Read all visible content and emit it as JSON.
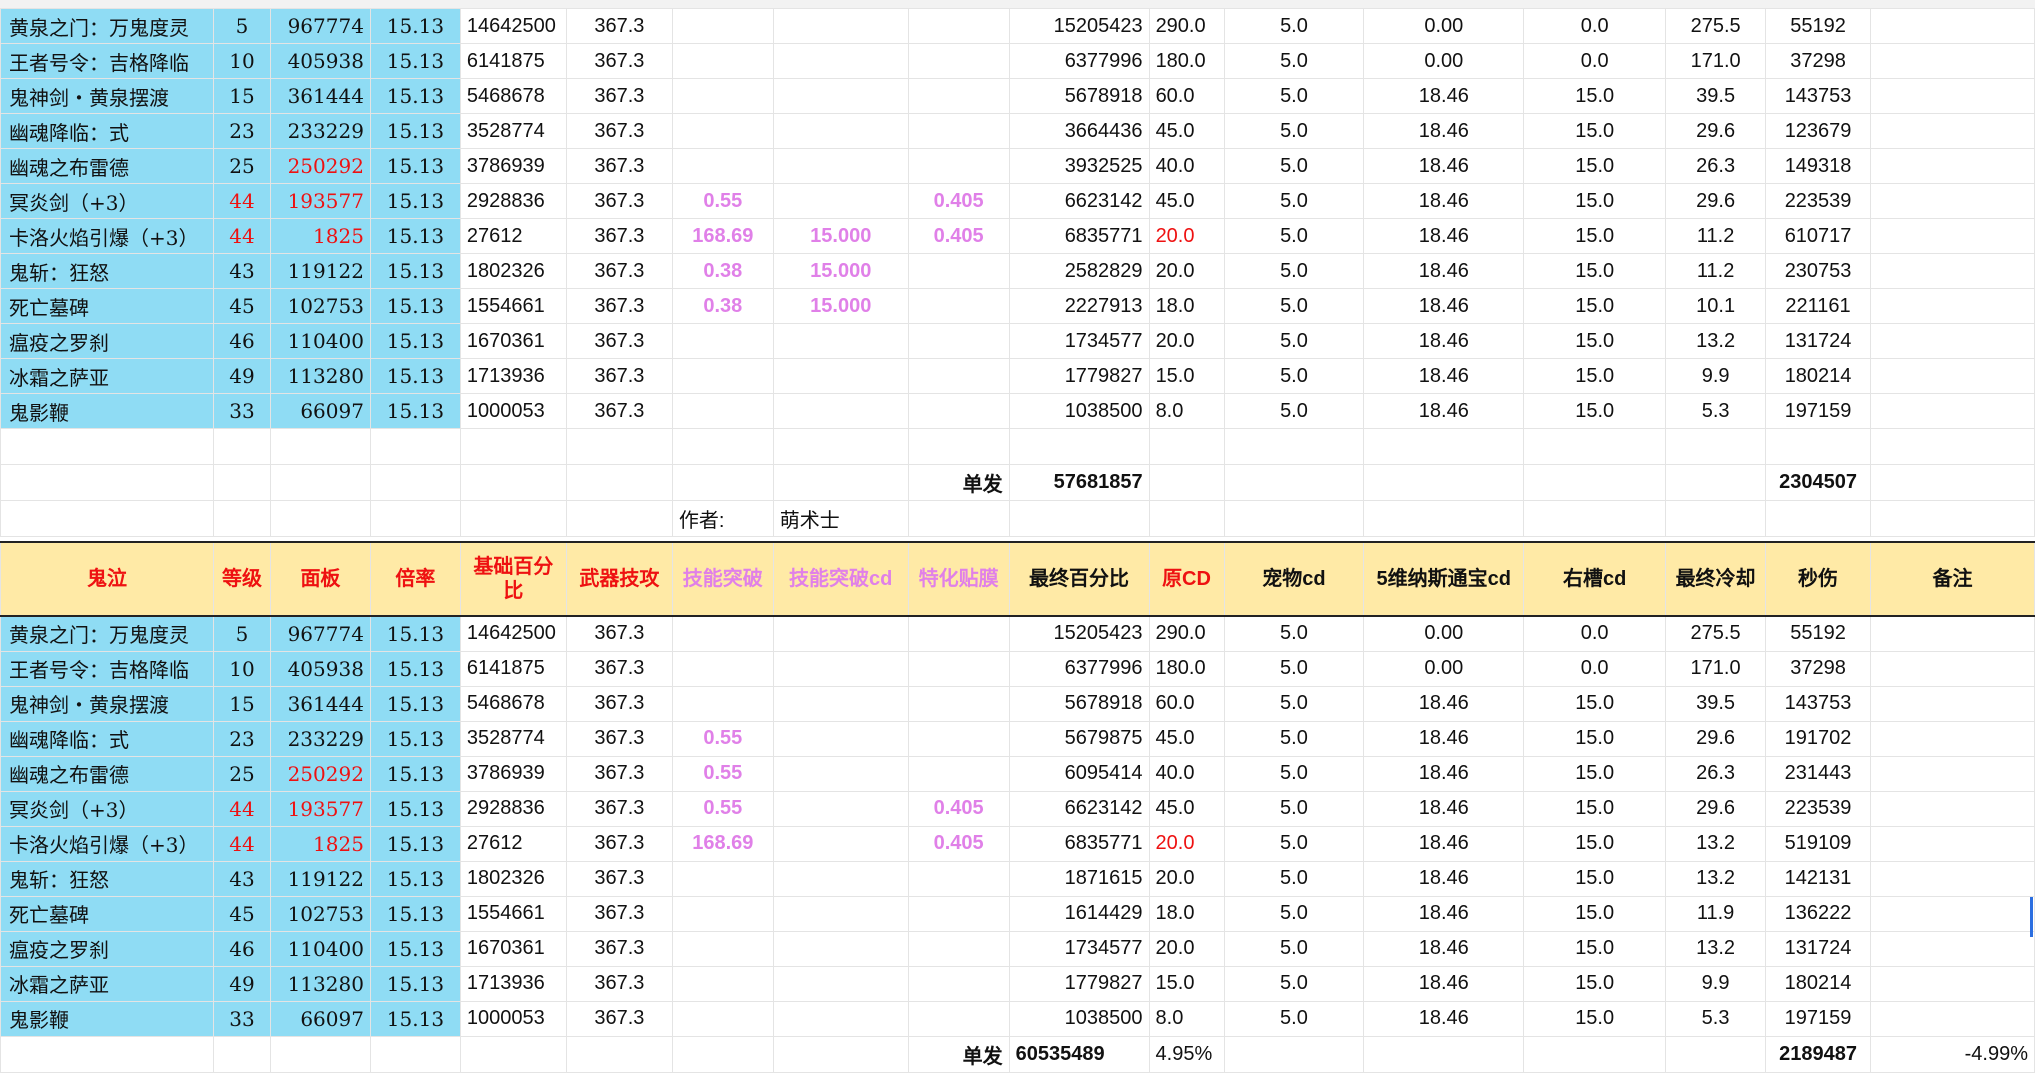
{
  "author_label": "作者:",
  "author_name": "萌术士",
  "header": {
    "c1": "鬼泣",
    "c2": "等级",
    "c3": "面板",
    "c4": "倍率",
    "c5": "基础百分比",
    "c6": "武器技攻",
    "c7": "技能突破",
    "c8": "技能突破cd",
    "c9": "特化贴膜",
    "c10": "最终百分比",
    "c11": "原CD",
    "c12": "宠物cd",
    "c13": "5维纳斯通宝cd",
    "c14": "右槽cd",
    "c15": "最终冷却",
    "c16": "秒伤",
    "c17": "备注"
  },
  "table1": {
    "rows": [
      [
        "黄泉之门：万鬼度灵",
        "5",
        "967774",
        "15.13",
        "14642500",
        "367.3",
        "",
        "",
        "",
        "15205423",
        "290.0",
        "5.0",
        "0.00",
        "0.0",
        "275.5",
        "55192",
        ""
      ],
      [
        "王者号令：吉格降临",
        "10",
        "405938",
        "15.13",
        "6141875",
        "367.3",
        "",
        "",
        "",
        "6377996",
        "180.0",
        "5.0",
        "0.00",
        "0.0",
        "171.0",
        "37298",
        ""
      ],
      [
        "鬼神剑・黄泉摆渡",
        "15",
        "361444",
        "15.13",
        "5468678",
        "367.3",
        "",
        "",
        "",
        "5678918",
        "60.0",
        "5.0",
        "18.46",
        "15.0",
        "39.5",
        "143753",
        ""
      ],
      [
        "幽魂降临：式",
        "23",
        "233229",
        "15.13",
        "3528774",
        "367.3",
        "",
        "",
        "",
        "3664436",
        "45.0",
        "5.0",
        "18.46",
        "15.0",
        "29.6",
        "123679",
        ""
      ],
      [
        "幽魂之布雷德",
        "25",
        "250292",
        "15.13",
        "3786939",
        "367.3",
        "",
        "",
        "",
        "3932525",
        "40.0",
        "5.0",
        "18.46",
        "15.0",
        "26.3",
        "149318",
        ""
      ],
      [
        "冥炎剑（+3）",
        "44",
        "193577",
        "15.13",
        "2928836",
        "367.3",
        "0.55",
        "",
        "0.405",
        "6623142",
        "45.0",
        "5.0",
        "18.46",
        "15.0",
        "29.6",
        "223539",
        ""
      ],
      [
        "卡洛火焰引爆（+3）",
        "44",
        "1825",
        "15.13",
        "27612",
        "367.3",
        "168.69",
        "15.000",
        "0.405",
        "6835771",
        "20.0",
        "5.0",
        "18.46",
        "15.0",
        "11.2",
        "610717",
        ""
      ],
      [
        "鬼斩：狂怒",
        "43",
        "119122",
        "15.13",
        "1802326",
        "367.3",
        "0.38",
        "15.000",
        "",
        "2582829",
        "20.0",
        "5.0",
        "18.46",
        "15.0",
        "11.2",
        "230753",
        ""
      ],
      [
        "死亡墓碑",
        "45",
        "102753",
        "15.13",
        "1554661",
        "367.3",
        "0.38",
        "15.000",
        "",
        "2227913",
        "18.0",
        "5.0",
        "18.46",
        "15.0",
        "10.1",
        "221161",
        ""
      ],
      [
        "瘟疫之罗刹",
        "46",
        "110400",
        "15.13",
        "1670361",
        "367.3",
        "",
        "",
        "",
        "1734577",
        "20.0",
        "5.0",
        "18.46",
        "15.0",
        "13.2",
        "131724",
        ""
      ],
      [
        "冰霜之萨亚",
        "49",
        "113280",
        "15.13",
        "1713936",
        "367.3",
        "",
        "",
        "",
        "1779827",
        "15.0",
        "5.0",
        "18.46",
        "15.0",
        "9.9",
        "180214",
        ""
      ],
      [
        "鬼影鞭",
        "33",
        "66097",
        "15.13",
        "1000053",
        "367.3",
        "",
        "",
        "",
        "1038500",
        "8.0",
        "5.0",
        "18.46",
        "15.0",
        "5.3",
        "197159",
        ""
      ]
    ],
    "total_label": "单发",
    "total_value": "57681857",
    "total_dps": "2304507"
  },
  "table2": {
    "rows": [
      [
        "黄泉之门：万鬼度灵",
        "5",
        "967774",
        "15.13",
        "14642500",
        "367.3",
        "",
        "",
        "",
        "15205423",
        "290.0",
        "5.0",
        "0.00",
        "0.0",
        "275.5",
        "55192",
        ""
      ],
      [
        "王者号令：吉格降临",
        "10",
        "405938",
        "15.13",
        "6141875",
        "367.3",
        "",
        "",
        "",
        "6377996",
        "180.0",
        "5.0",
        "0.00",
        "0.0",
        "171.0",
        "37298",
        ""
      ],
      [
        "鬼神剑・黄泉摆渡",
        "15",
        "361444",
        "15.13",
        "5468678",
        "367.3",
        "",
        "",
        "",
        "5678918",
        "60.0",
        "5.0",
        "18.46",
        "15.0",
        "39.5",
        "143753",
        ""
      ],
      [
        "幽魂降临：式",
        "23",
        "233229",
        "15.13",
        "3528774",
        "367.3",
        "0.55",
        "",
        "",
        "5679875",
        "45.0",
        "5.0",
        "18.46",
        "15.0",
        "29.6",
        "191702",
        ""
      ],
      [
        "幽魂之布雷德",
        "25",
        "250292",
        "15.13",
        "3786939",
        "367.3",
        "0.55",
        "",
        "",
        "6095414",
        "40.0",
        "5.0",
        "18.46",
        "15.0",
        "26.3",
        "231443",
        ""
      ],
      [
        "冥炎剑（+3）",
        "44",
        "193577",
        "15.13",
        "2928836",
        "367.3",
        "0.55",
        "",
        "0.405",
        "6623142",
        "45.0",
        "5.0",
        "18.46",
        "15.0",
        "29.6",
        "223539",
        ""
      ],
      [
        "卡洛火焰引爆（+3）",
        "44",
        "1825",
        "15.13",
        "27612",
        "367.3",
        "168.69",
        "",
        "0.405",
        "6835771",
        "20.0",
        "5.0",
        "18.46",
        "15.0",
        "13.2",
        "519109",
        ""
      ],
      [
        "鬼斩：狂怒",
        "43",
        "119122",
        "15.13",
        "1802326",
        "367.3",
        "",
        "",
        "",
        "1871615",
        "20.0",
        "5.0",
        "18.46",
        "15.0",
        "13.2",
        "142131",
        ""
      ],
      [
        "死亡墓碑",
        "45",
        "102753",
        "15.13",
        "1554661",
        "367.3",
        "",
        "",
        "",
        "1614429",
        "18.0",
        "5.0",
        "18.46",
        "15.0",
        "11.9",
        "136222",
        ""
      ],
      [
        "瘟疫之罗刹",
        "46",
        "110400",
        "15.13",
        "1670361",
        "367.3",
        "",
        "",
        "",
        "1734577",
        "20.0",
        "5.0",
        "18.46",
        "15.0",
        "13.2",
        "131724",
        ""
      ],
      [
        "冰霜之萨亚",
        "49",
        "113280",
        "15.13",
        "1713936",
        "367.3",
        "",
        "",
        "",
        "1779827",
        "15.0",
        "5.0",
        "18.46",
        "15.0",
        "9.9",
        "180214",
        ""
      ],
      [
        "鬼影鞭",
        "33",
        "66097",
        "15.13",
        "1000053",
        "367.3",
        "",
        "",
        "",
        "1038500",
        "8.0",
        "5.0",
        "18.46",
        "15.0",
        "5.3",
        "197159",
        ""
      ]
    ],
    "total_label": "单发",
    "total_value": "60535489",
    "total_pct": "4.95%",
    "total_dps": "2189487",
    "total_note": "-4.99%"
  },
  "colors": {
    "skill_bg": "#8fdcf4",
    "header_bg": "#ffeaa6",
    "red": "#ee1111",
    "pink": "#e080e8"
  }
}
